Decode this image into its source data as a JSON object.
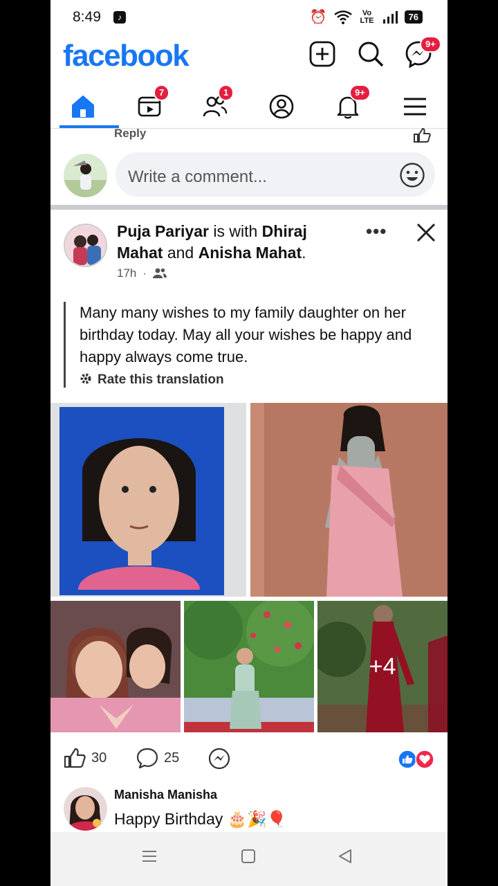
{
  "status_bar": {
    "time": "8:49",
    "network": "Vo LTE",
    "battery": "76"
  },
  "app": {
    "logo": "facebook"
  },
  "header_badges": {
    "messenger": "9+"
  },
  "tabs": [
    {
      "name": "home",
      "icon": "home-icon",
      "badge": ""
    },
    {
      "name": "video",
      "icon": "video-icon",
      "badge": "7"
    },
    {
      "name": "friends",
      "icon": "friends-icon",
      "badge": "1"
    },
    {
      "name": "profile",
      "icon": "profile-icon",
      "badge": ""
    },
    {
      "name": "notifications",
      "icon": "bell-icon",
      "badge": "9+"
    },
    {
      "name": "menu",
      "icon": "menu-icon",
      "badge": ""
    }
  ],
  "reply_label": "Reply",
  "comment_box": {
    "placeholder": "Write a comment..."
  },
  "post": {
    "author": "Puja Pariyar",
    "with_text": "is with",
    "tagged_1": "Dhiraj Mahat",
    "and_text": "and",
    "tagged_2": "Anisha Mahat",
    "period": ".",
    "time": "17h",
    "separator": "·",
    "text": "Many many wishes to my family daughter on her birthday today. May all your wishes be happy and happy always come true.",
    "rate_translation": "Rate this translation",
    "more_photos": "+4",
    "likes": "30",
    "comments": "25"
  },
  "comment": {
    "name": "Manisha Manisha",
    "text": "Happy Birthday 🎂🎉🎈"
  },
  "colors": {
    "brand": "#1877f2",
    "badge": "#e41e3f",
    "like": "#1877f2",
    "love": "#f02849"
  }
}
